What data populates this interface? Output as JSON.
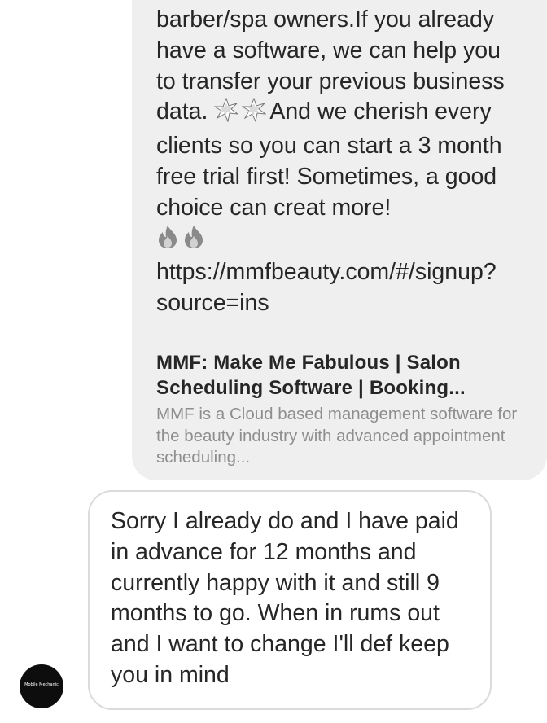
{
  "conversation": {
    "incoming": {
      "text_before_sparkles": "barber/spa owners.If you already have a software, we can help you to transfer your previous business data. ",
      "sparkle_icons": [
        "collision-icon",
        "collision-icon"
      ],
      "text_after_sparkles": "And we cherish every clients so you can start a 3 month free trial first! Sometimes, a good choice can creat more!",
      "fire_icons": [
        "fire-icon",
        "fire-icon"
      ],
      "link_text": "https://mmfbeauty.com/#/signup?source=ins",
      "link_preview": {
        "title": "MMF: Make Me Fabulous | Salon Scheduling Software | Booking...",
        "description": "MMF is a Cloud based management software for the beauty industry with advanced appointment scheduling..."
      }
    },
    "outgoing": {
      "text": "Sorry I already do and I have paid in advance for 12 months and currently happy with it and still 9 months to go. When in rums out and I want to change I'll def keep you in mind"
    },
    "avatar": {
      "label": "Mobile Mechanic"
    }
  },
  "colors": {
    "incoming_bubble": "#efefef",
    "outgoing_border": "#dbdbdb",
    "text": "#262626",
    "muted_text": "#8e8e8e",
    "avatar_bg": "#0d0d0d"
  }
}
